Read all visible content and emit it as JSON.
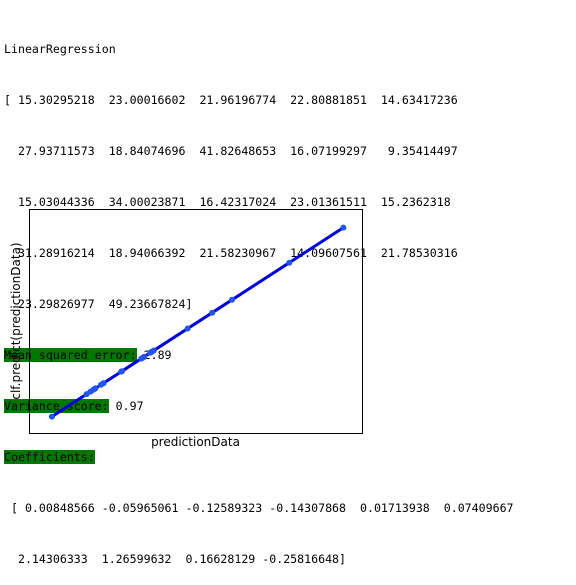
{
  "output": {
    "model_name": "LinearRegression",
    "prediction_lines": [
      "[ 15.30295218  23.00016602  21.96196774  22.80881851  14.63417236",
      "  27.93711573  18.84074696  41.82648653  16.07199297   9.35414497",
      "  15.03044336  34.00023871  16.42317024  23.01361511  15.2362318 ",
      "  31.28916214  18.94066392  21.58230967  14.09607561  21.78530316",
      "  23.29826977  49.23667824]"
    ],
    "mse_label": "Mean squared error:",
    "mse_value": " 2.89",
    "variance_label": "Variance score:",
    "variance_value": " 0.97",
    "coef_label": "Coefficients:",
    "coef_lines": [
      " [ 0.00848566 -0.05965061 -0.12589323 -0.14307868  0.01713938  0.07409667",
      "  2.14306333  1.26599632  0.16628129 -0.25816648]"
    ],
    "highlight_color": "#007700"
  },
  "chart_data": {
    "type": "line",
    "xlabel": "predictionData",
    "ylabel": "clf.predict(predictionData)",
    "xlim": [
      8,
      50
    ],
    "ylim": [
      8,
      50
    ],
    "ticks_visible": false,
    "grid": false,
    "line_color": "#0000dd",
    "marker_color": "#2255ee",
    "x": [
      15.30295218,
      23.00016602,
      21.96196774,
      22.80881851,
      14.63417236,
      27.93711573,
      18.84074696,
      41.82648653,
      16.07199297,
      9.35414497,
      15.03044336,
      34.00023871,
      16.42317024,
      23.01361511,
      15.2362318,
      31.28916214,
      18.94066392,
      21.58230967,
      14.09607561,
      21.78530316,
      23.29826977,
      49.23667824
    ],
    "y": [
      15.30295218,
      23.00016602,
      21.96196774,
      22.80881851,
      14.63417236,
      27.93711573,
      18.84074696,
      41.82648653,
      16.07199297,
      9.35414497,
      15.03044336,
      34.00023871,
      16.42317024,
      23.01361511,
      15.2362318,
      31.28916214,
      18.94066392,
      21.58230967,
      14.09607561,
      21.78530316,
      23.29826977,
      49.23667824
    ]
  }
}
